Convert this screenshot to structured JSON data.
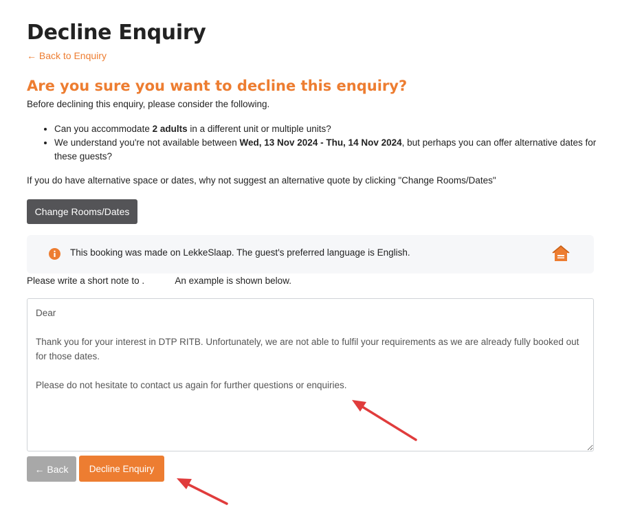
{
  "page": {
    "title": "Decline Enquiry",
    "back_link": "← Back to Enquiry"
  },
  "confirm": {
    "heading": "Are you sure you want to decline this enquiry?",
    "intro": "Before declining this enquiry, please consider the following.",
    "items": [
      {
        "pre": "Can you accommodate ",
        "bold": "2 adults",
        "post": " in a different unit or multiple units?"
      },
      {
        "pre": "We understand you're not available between ",
        "bold": "Wed, 13 Nov 2024 - Thu, 14 Nov 2024",
        "post": ", but perhaps you can offer alternative dates for these guests?"
      }
    ],
    "suggestion": "If you do have alternative space or dates, why not suggest an alternative quote by clicking \"Change Rooms/Dates\"",
    "change_button": "Change Rooms/Dates"
  },
  "info": {
    "text": "This booking was made on LekkeSlaap. The guest's preferred language is English.",
    "icon": "info-circle-icon",
    "brand_icon": "house-icon",
    "accent_color": "#ed7d31"
  },
  "note": {
    "label": "Please write a short note to .            An example is shown below.",
    "value": "Dear \n\nThank you for your interest in DTP RITB. Unfortunately, we are not able to fulfil your requirements as we are already fully booked out for those dates.\n\nPlease do not hesitate to contact us again for further questions or enquiries."
  },
  "actions": {
    "back_label": "← Back",
    "decline_label": "Decline Enquiry"
  },
  "colors": {
    "accent": "#ed7d31",
    "dark_button": "#545457",
    "muted_button": "#a8a8a8",
    "annotation_arrow": "#e03c3c"
  }
}
